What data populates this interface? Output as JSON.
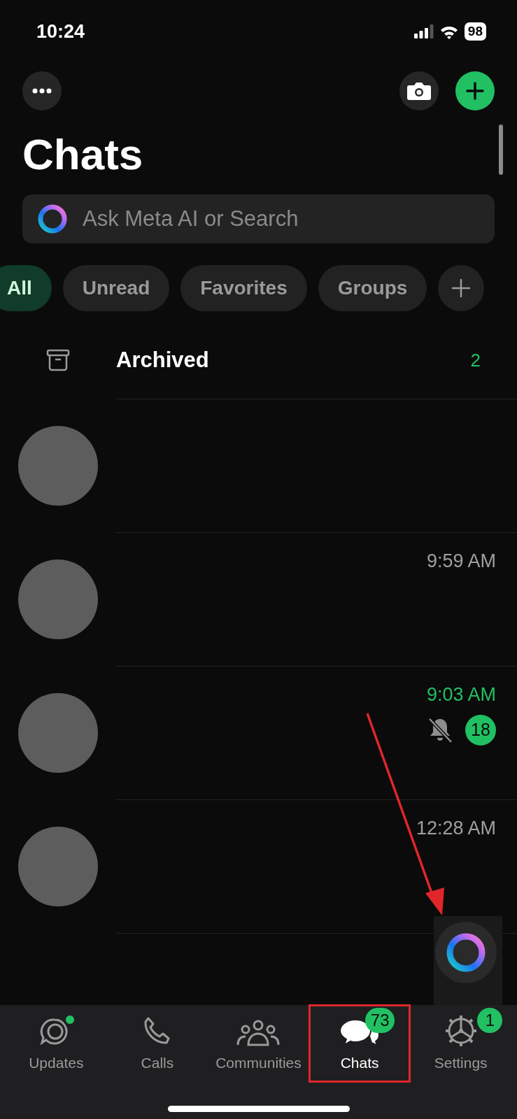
{
  "status_bar": {
    "time": "10:24",
    "battery": "98"
  },
  "title": "Chats",
  "search": {
    "placeholder": "Ask Meta AI or Search"
  },
  "filters": [
    {
      "label": "All",
      "selected": true
    },
    {
      "label": "Unread",
      "selected": false
    },
    {
      "label": "Favorites",
      "selected": false
    },
    {
      "label": "Groups",
      "selected": false
    }
  ],
  "archived": {
    "label": "Archived",
    "count": "2"
  },
  "chats": [
    {
      "kind": "chat"
    },
    {
      "kind": "chat",
      "time": "9:59 AM",
      "unread": false,
      "muted": false
    },
    {
      "kind": "chat",
      "time": "9:03 AM",
      "unread": true,
      "muted": true,
      "badge": "18"
    },
    {
      "kind": "chat",
      "time": "12:28 AM",
      "unread": false,
      "muted": false
    }
  ],
  "tabs": [
    {
      "kind": "updates",
      "label": "Updates",
      "selected": false,
      "dot": true
    },
    {
      "kind": "calls",
      "label": "Calls",
      "selected": false
    },
    {
      "kind": "communities",
      "label": "Communities",
      "selected": false
    },
    {
      "kind": "chats",
      "label": "Chats",
      "selected": true,
      "badge": "73",
      "highlighted": true
    },
    {
      "kind": "settings",
      "label": "Settings",
      "selected": false,
      "badge": "1"
    }
  ],
  "meta_ai_button": {
    "pointed_at": true
  }
}
